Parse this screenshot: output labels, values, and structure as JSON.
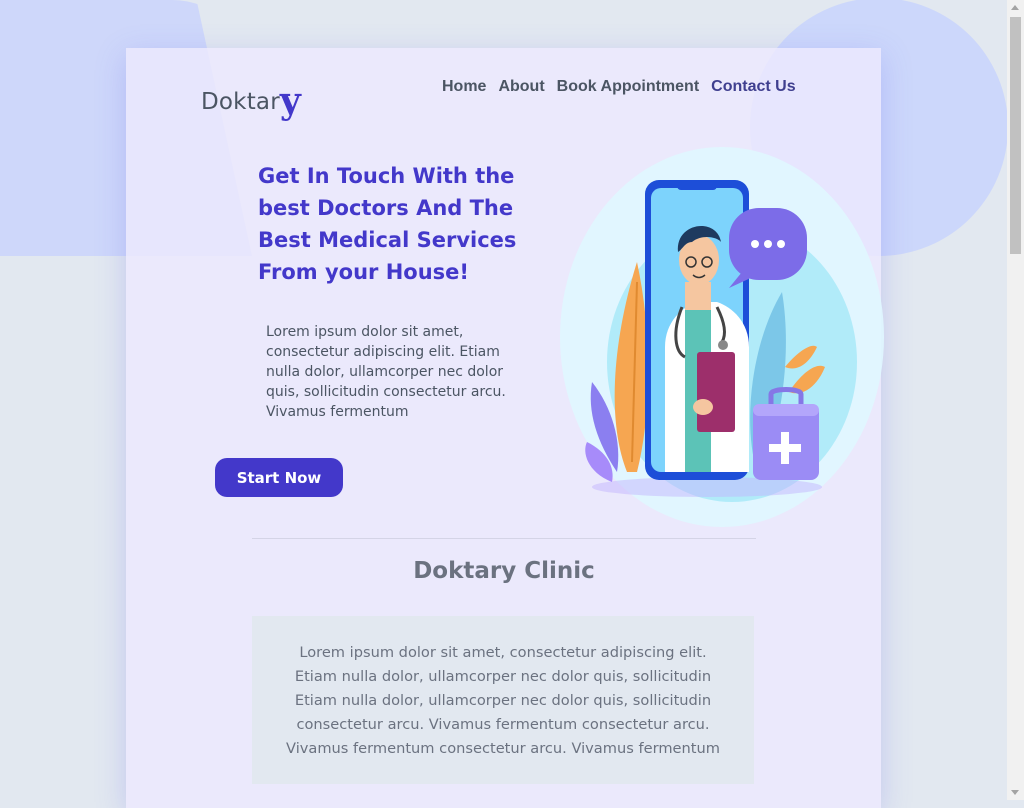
{
  "brand": {
    "logo_text": "Doktar",
    "logo_accent": "y"
  },
  "nav": {
    "items": [
      "Home",
      "About",
      "Book Appointment",
      "Contact Us"
    ]
  },
  "hero": {
    "title": "Get In Touch With the best Doctors And The Best Medical Services From your House!",
    "text": "Lorem ipsum dolor sit amet, consectetur adipiscing elit. Etiam nulla dolor, ullamcorper nec dolor quis, sollicitudin consectetur arcu. Vivamus fermentum",
    "cta_label": "Start Now"
  },
  "clinic": {
    "title": "Doktary Clinic",
    "text": "Lorem ipsum dolor sit amet, consectetur adipiscing elit. Etiam nulla dolor, ullamcorper nec dolor quis, sollicitudin Etiam nulla dolor, ullamcorper nec dolor quis, sollicitudin consectetur arcu. Vivamus fermentum consectetur arcu. Vivamus fermentum consectetur arcu. Vivamus fermentum"
  },
  "colors": {
    "accent": "#4338ca",
    "page_background": "#ede9fe",
    "body_background": "#e2e8f0",
    "text_gray": "#4b5563"
  },
  "icons": {
    "chat_bubble": "chat-bubble-icon",
    "medical_kit": "medical-kit-icon"
  }
}
